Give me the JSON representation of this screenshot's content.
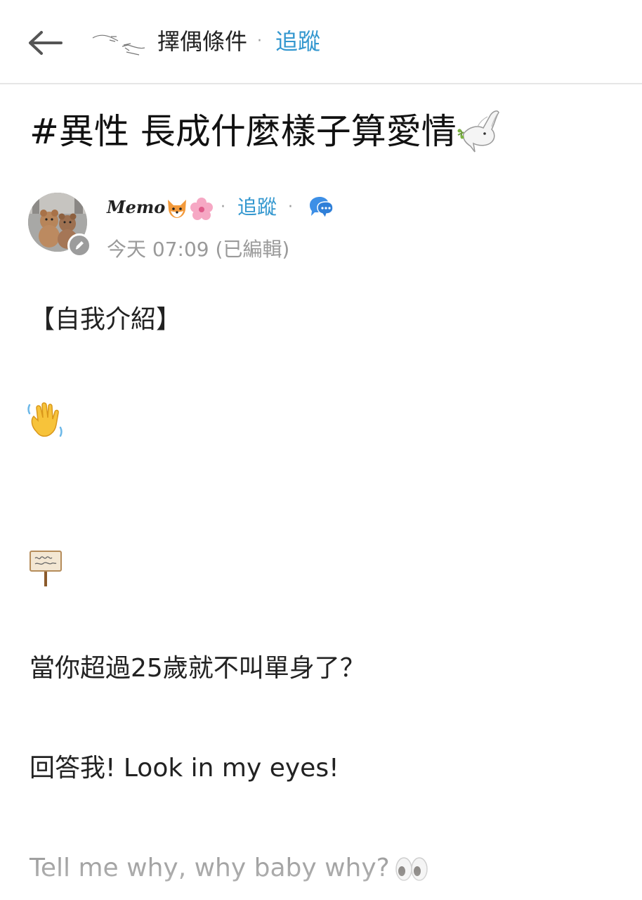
{
  "header": {
    "board_name": "擇偶條件",
    "separator": "·",
    "follow_label": "追蹤"
  },
  "post": {
    "title": "#異性 長成什麼樣子算愛情",
    "author": {
      "name": "Memo",
      "separator1": "·",
      "follow_label": "追蹤",
      "separator2": "·",
      "timestamp": "今天 07:09 (已編輯)"
    },
    "body": {
      "intro": "【自我介紹】",
      "question": "當你超過25歲就不叫單身了？",
      "answer": "回答我! Look in my eyes!",
      "tell": "Tell me why, why baby why?"
    }
  },
  "icons": {
    "back": "arrow-left-icon",
    "board_logo": "creation-hands-icon",
    "title_emoji": "dove-icon",
    "author_emoji1": "fox-icon",
    "author_emoji2": "cherry-blossom-icon",
    "chat": "chat-bubble-icon",
    "badge": "pen-icon",
    "wave": "waving-hand-icon",
    "sign": "placard-icon",
    "eyes": "eyes-icon"
  },
  "colors": {
    "accent": "#3397cf",
    "muted": "#9a9a9a",
    "text": "#222222"
  }
}
